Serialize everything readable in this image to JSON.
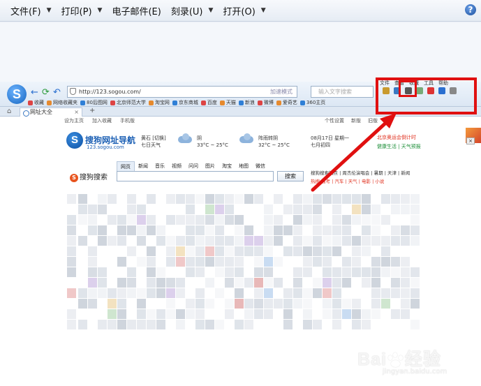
{
  "menubar": {
    "items": [
      {
        "label": "文件(F)",
        "has_caret": true
      },
      {
        "label": "打印(P)",
        "has_caret": true
      },
      {
        "label": "电子邮件(E)",
        "has_caret": false
      },
      {
        "label": "刻录(U)",
        "has_caret": true
      },
      {
        "label": "打开(O)",
        "has_caret": true
      }
    ],
    "help_glyph": "?"
  },
  "browser": {
    "logo_letter": "S",
    "address": "http://123.sogou.com/",
    "address_tail": "加速模式",
    "search_placeholder": "输入文字搜索",
    "top_menu": [
      "文件",
      "查看",
      "收藏",
      "工具",
      "帮助"
    ],
    "bookmarks": [
      "收藏",
      "网络收藏夹",
      "80后图网",
      "北京师范大学",
      "淘宝网",
      "京东商城",
      "百度",
      "天猫",
      "新浪",
      "微博",
      "爱奇艺",
      "360主页"
    ],
    "tab_title": "网址大全",
    "tab_close": "×",
    "newtab": "+",
    "page_top_left": [
      "设为主页",
      "加入收藏",
      "手机版"
    ],
    "page_top_right": [
      "个性设置",
      "新版",
      "旧版"
    ]
  },
  "sogou": {
    "logo_letter": "S",
    "title": "搜狗网址导航",
    "url": "123.sogou.com",
    "city": "黄石 [切换]",
    "forecast_label": "七日天气",
    "weather_today": {
      "cond": "阴",
      "temp": "33°C ~ 25°C"
    },
    "weather_tomorrow": {
      "cond": "阵雨转阴",
      "temp": "32°C ~ 25°C",
      "day": "七月初四"
    },
    "date": "08月17日 星期一",
    "lunar": "七月初四",
    "search_tabs": [
      "网页",
      "新闻",
      "音乐",
      "视频",
      "问问",
      "图片",
      "淘宝",
      "地图",
      "微信"
    ],
    "search_logo": "搜狗搜索",
    "search_button": "搜索",
    "hot_line1": "搜狗搜索热点 | 周杰伦演唱会 | 暑期 | 天津 | 新闻",
    "hot_line2": "热搜 高考 | 汽车 | 天气 | 电影 | 小说",
    "news_red": "北京奥运会倒计时",
    "news_green": "健康生活 | 天气预报"
  },
  "annotation": {
    "colors": {
      "box": "#e01010",
      "arrow": "#e01010"
    }
  },
  "watermark": {
    "text_main": "Bai",
    "text_main2": "经验",
    "text_sub": "jingyan.baidu.com"
  }
}
